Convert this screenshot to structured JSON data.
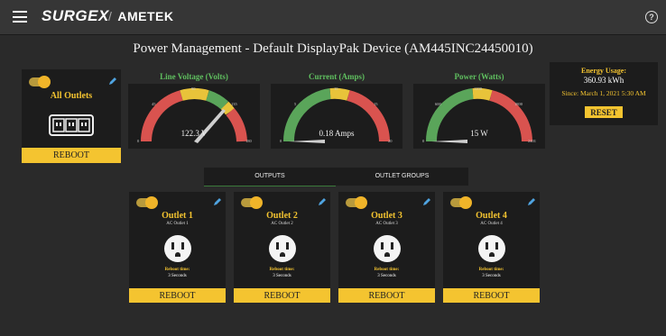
{
  "header": {
    "brand": "SURGEX",
    "company": "AMETEK"
  },
  "page": {
    "title": "Power Management - Default DisplayPak Device (AM445INC24450010)"
  },
  "all_outlets": {
    "label": "All Outlets",
    "reboot_label": "REBOOT"
  },
  "gauges": [
    {
      "title": "Line Voltage (Volts)",
      "value": 122.3,
      "display": "122.3 V",
      "ticks": {
        "min": "0",
        "t1": "45",
        "t2": "90",
        "t3": "135",
        "max": "180"
      }
    },
    {
      "title": "Current (Amps)",
      "value": 0.18,
      "display": "0.18 Amps",
      "ticks": {
        "min": "0",
        "t1": "5",
        "t2": "10",
        "t3": "15",
        "max": "20"
      }
    },
    {
      "title": "Power (Watts)",
      "value": 15,
      "display": "15 W",
      "ticks": {
        "min": "0",
        "t1": "600",
        "t2": "1200",
        "t3": "1800",
        "max": "2401"
      }
    }
  ],
  "energy": {
    "title": "Energy Usage:",
    "value": "360.93 kWh",
    "since": "Since: March 1, 2021 5:30 AM",
    "reset_label": "RESET"
  },
  "tabs": {
    "outputs": "OUTPUTS",
    "groups": "OUTLET GROUPS"
  },
  "outlets": [
    {
      "name": "Outlet 1",
      "desc": "AC Outlet 1",
      "reboot_time_label": "Reboot time:",
      "reboot_time": "3 Seconds",
      "reboot_label": "REBOOT"
    },
    {
      "name": "Outlet 2",
      "desc": "AC Outlet 2",
      "reboot_time_label": "Reboot time:",
      "reboot_time": "3 Seconds",
      "reboot_label": "REBOOT"
    },
    {
      "name": "Outlet 3",
      "desc": "AC Outlet 3",
      "reboot_time_label": "Reboot time:",
      "reboot_time": "3 Seconds",
      "reboot_label": "REBOOT"
    },
    {
      "name": "Outlet 4",
      "desc": "AC Outlet 4",
      "reboot_time_label": "Reboot time:",
      "reboot_time": "3 Seconds",
      "reboot_label": "REBOOT"
    }
  ],
  "colors": {
    "accent": "#f4c430",
    "gauge_green": "#5aa55a",
    "gauge_yellow": "#e8c33a",
    "gauge_red": "#d9534f"
  }
}
